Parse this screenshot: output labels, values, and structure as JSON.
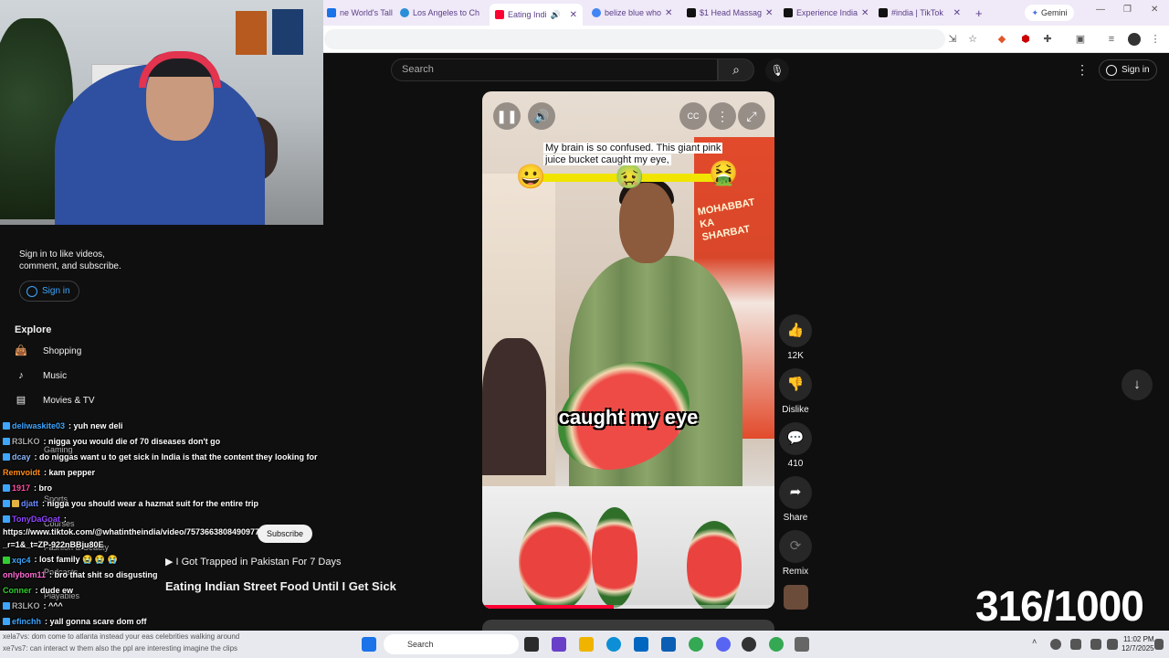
{
  "browser": {
    "tabs": [
      {
        "label": "ne World's Talle",
        "color": "#1a73e8"
      },
      {
        "label": "Los Angeles to Ch",
        "color": "#2a8fd8"
      },
      {
        "label": "Eating Indi",
        "color": "#ff0033",
        "active": true
      },
      {
        "label": "belize blue who",
        "color": "#4285f4"
      },
      {
        "label": "$1 Head Massag",
        "color": "#111111"
      },
      {
        "label": "Experience India",
        "color": "#111111"
      },
      {
        "label": "#india | TikTok",
        "color": "#111111"
      }
    ],
    "new_tab": "+",
    "gemini_label": "Gemini",
    "window_controls": [
      "—",
      "❐",
      "✕"
    ]
  },
  "youtube": {
    "search_placeholder": "Search",
    "sign_in_label": "Sign in",
    "sidebar": {
      "signin_prompt": "Sign in to like videos, comment, and subscribe.",
      "signin_button": "Sign in",
      "explore_title": "Explore",
      "items": [
        {
          "label": "Shopping",
          "icon": "shopping-bag-icon"
        },
        {
          "label": "Music",
          "icon": "music-note-icon"
        },
        {
          "label": "Movies & TV",
          "icon": "film-icon"
        }
      ],
      "faint_items": [
        "Gaming",
        "Sports",
        "Courses",
        "Fashion & Beauty",
        "Podcasts",
        "Playables"
      ]
    },
    "short": {
      "caption_top": "My brain is so confused. This giant pink juice bucket caught my eye,",
      "caption_mid": "caught my eye",
      "sign_text": "MOHABBAT KA SHARBAT",
      "emojis": [
        "😀",
        "🤢",
        "🤮"
      ],
      "progress": 0.45
    },
    "actions": [
      {
        "icon": "thumbs-up-icon",
        "label": "12K"
      },
      {
        "icon": "thumbs-down-icon",
        "label": "Dislike"
      },
      {
        "icon": "comment-icon",
        "label": "410"
      },
      {
        "icon": "share-icon",
        "label": "Share"
      },
      {
        "icon": "remix-icon",
        "label": "Remix"
      }
    ]
  },
  "overlays": {
    "suggestion": "I Got Trapped in Pakistan For 7 Days",
    "video_title": "Eating Indian Street Food Until I Get Sick",
    "subscribe": "Subscribe",
    "counter": "316/1000"
  },
  "chat": [
    {
      "user": "deliwaskite03",
      "color": "#3ea6ff",
      "msg": ": yuh new deli"
    },
    {
      "user": "R3LKO",
      "color": "#aaaaaa",
      "msg": ": nigga you would die of 70 diseases don't go"
    },
    {
      "user": "dcay",
      "color": "#8ab4f8",
      "msg": ": do niggas want u to get sick in India is that the content they looking for"
    },
    {
      "user": "Remvoidt",
      "color": "#ff8c1a",
      "msg": ": kam pepper"
    },
    {
      "user": "1917",
      "color": "#ff4fa3",
      "msg": ": bro"
    },
    {
      "user": "djatt",
      "color": "#6a8cff",
      "msg": ": nigga you should wear a hazmat suit for the entire trip"
    },
    {
      "user": "TonyDaGoat",
      "color": "#9146ff",
      "msg": ":"
    },
    {
      "user": "",
      "color": "#ffffff",
      "msg": "https://www.tiktok.com/@whatintheindia/video/757366380849097724"
    },
    {
      "user": "",
      "color": "#ffffff",
      "msg": "_r=1&_t=ZP-922nBBju80E"
    },
    {
      "user": "xqc4",
      "color": "#3ea6ff",
      "msg": ": lost family 😭 😭 😭"
    },
    {
      "user": "onlybom11",
      "color": "#ff6ad5",
      "msg": ": bro that shit so disgusting"
    },
    {
      "user": "Conner",
      "color": "#32cd32",
      "msg": ": dude ew"
    },
    {
      "user": "R3LKO",
      "color": "#aaaaaa",
      "msg": ": ^^^"
    },
    {
      "user": "efinchh",
      "color": "#3ea6ff",
      "msg": ": yall gonna scare dom off"
    }
  ],
  "taskbar": {
    "search_label": "Search",
    "time": "11:02 PM",
    "date": "12/7/2025",
    "bottom_text_1": "xela7vs: dom come to atlanta instead your eas celebrities walking around",
    "bottom_text_2": "xe7vs7: can interact w them also the ppl are interesting imagine the clips"
  }
}
